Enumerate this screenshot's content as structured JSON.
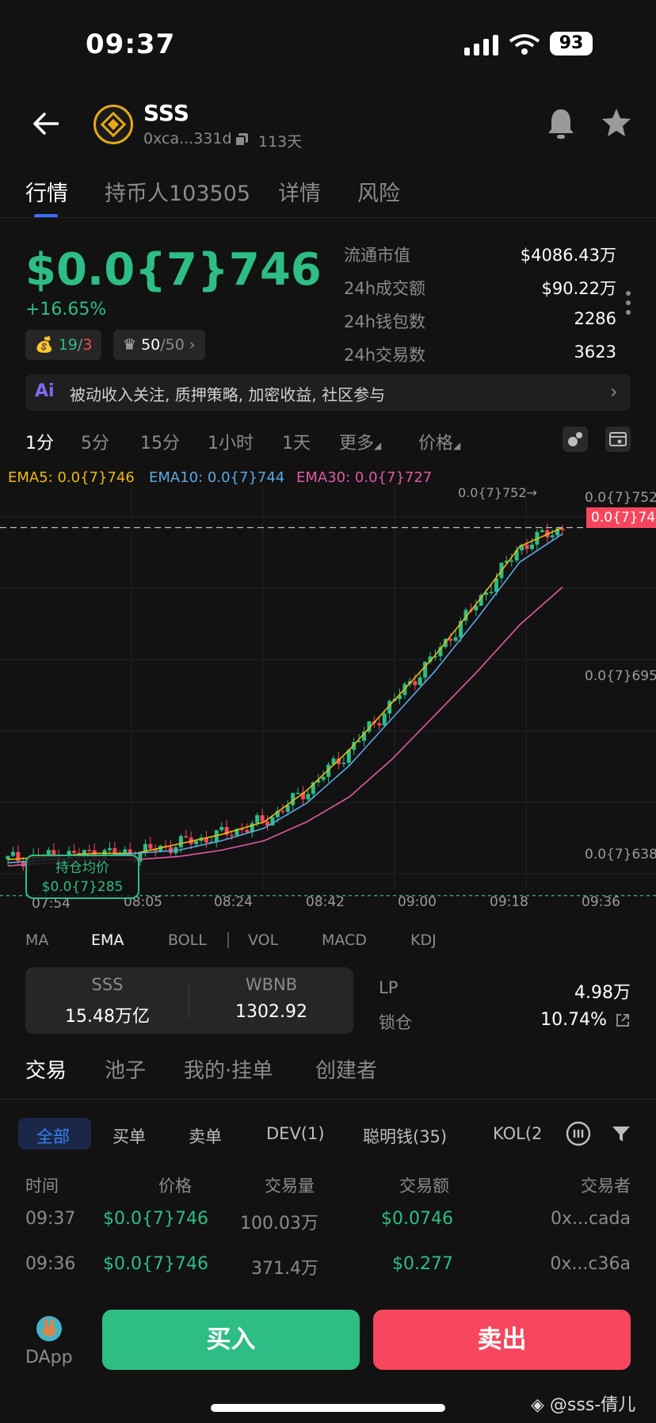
{
  "status_bar": {
    "time": "09:37",
    "battery": "93"
  },
  "header": {
    "token_name": "SSS",
    "address": "0xca...331d",
    "age": "113天"
  },
  "tabs": [
    "行情",
    "持币人103505",
    "详情",
    "风险"
  ],
  "price": {
    "value": "$0.0{7}746",
    "change": "+16.65%",
    "pill1_a": "19",
    "pill1_sep": "/",
    "pill1_b": "3",
    "pill2_a": "50",
    "pill2_b": "/50"
  },
  "stats": [
    {
      "label": "流通市值",
      "value": "$4086.43万"
    },
    {
      "label": "24h成交额",
      "value": "$90.22万"
    },
    {
      "label": "24h钱包数",
      "value": "2286"
    },
    {
      "label": "24h交易数",
      "value": "3623"
    }
  ],
  "ai_bar": {
    "text": "被动收入关注, 质押策略, 加密收益, 社区参与"
  },
  "intervals": [
    "1分",
    "5分",
    "15分",
    "1小时",
    "1天",
    "更多",
    "价格"
  ],
  "ema_legend": {
    "ema5": "EMA5: 0.0{7}746",
    "ema10": "EMA10: 0.0{7}744",
    "ema30": "EMA30: 0.0{7}727"
  },
  "chart_labels": {
    "high_marker": "0.0{7}752→",
    "current_price": "0.0{7}746",
    "y_ticks": [
      "0.0{7}752",
      "0.0{7}695",
      "0.0{7}638"
    ],
    "x_ticks": [
      "07:54",
      "08:05",
      "08:24",
      "08:42",
      "09:00",
      "09:18",
      "09:36"
    ],
    "avg_cost_title": "持仓均价",
    "avg_cost_value": "$0.0{7}285"
  },
  "chart_data": {
    "type": "candlestick",
    "y_unit": "×1e-7 USD (shown as 0.0{7}xxx)",
    "ylim": [
      633,
      757
    ],
    "y_ticks": [
      752,
      695,
      638
    ],
    "x_ticks": [
      "07:54",
      "08:05",
      "08:24",
      "08:42",
      "09:00",
      "09:18",
      "09:36"
    ],
    "current_price": 746,
    "high_marker": 752,
    "average_cost": 628.5,
    "series": [
      {
        "name": "EMA5",
        "color": "#f0b90b",
        "values": [
          640,
          641,
          642,
          642,
          645,
          648,
          652,
          662,
          675,
          690,
          705,
          722,
          740,
          746
        ]
      },
      {
        "name": "EMA10",
        "color": "#5aa9e6",
        "values": [
          639,
          640,
          641,
          642,
          643,
          646,
          650,
          658,
          670,
          685,
          700,
          717,
          735,
          744
        ]
      },
      {
        "name": "EMA30",
        "color": "#e05aa5",
        "values": [
          638,
          639,
          640,
          640,
          641,
          643,
          646,
          652,
          660,
          672,
          686,
          700,
          715,
          727
        ]
      }
    ]
  },
  "indicators": [
    "MA",
    "EMA",
    "BOLL",
    "VOL",
    "MACD",
    "KDJ"
  ],
  "pool": {
    "token_a": "SSS",
    "token_a_amount": "15.48万亿",
    "token_b": "WBNB",
    "token_b_amount": "1302.92",
    "lp_label": "LP",
    "lp_value": "4.98万",
    "lock_label": "锁仓",
    "lock_value": "10.74%"
  },
  "sub_tabs": [
    "交易",
    "池子",
    "我的·挂单",
    "创建者"
  ],
  "filters": [
    "全部",
    "买单",
    "卖单",
    "DEV(1)",
    "聪明钱(35)",
    "KOL(2"
  ],
  "trades_table": {
    "headers": [
      "时间",
      "价格",
      "交易量",
      "交易额",
      "交易者"
    ],
    "rows": [
      [
        "09:37",
        "$0.0{7}746",
        "100.03万",
        "$0.0746",
        "0x...cada"
      ],
      [
        "09:36",
        "$0.0{7}746",
        "371.4万",
        "$0.277",
        "0x...c36a"
      ]
    ]
  },
  "bottom": {
    "dapp": "DApp",
    "buy": "买入",
    "sell": "卖出",
    "watermark": "@sss-倩儿"
  },
  "colors": {
    "up": "#2ebd85",
    "down": "#f6465d",
    "accent": "#3b6cf6"
  }
}
